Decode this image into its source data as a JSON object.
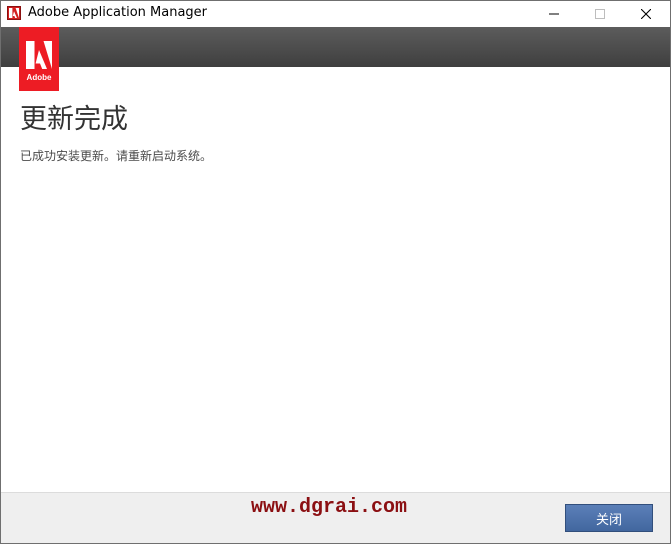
{
  "window": {
    "title": "Adobe Application Manager",
    "controls": {
      "minimize": "—",
      "maximize": "☐",
      "close": "✕"
    }
  },
  "logo": {
    "text": "Adobe",
    "color": "#ed1c24"
  },
  "content": {
    "heading": "更新完成",
    "message": "已成功安装更新。请重新启动系统。"
  },
  "watermark": {
    "text": "www.dgrai.com"
  },
  "footer": {
    "close_label": "关闭"
  },
  "colors": {
    "header_band": "#4a4a4a",
    "button": "#4a6ea8",
    "watermark": "#8b0f12"
  }
}
